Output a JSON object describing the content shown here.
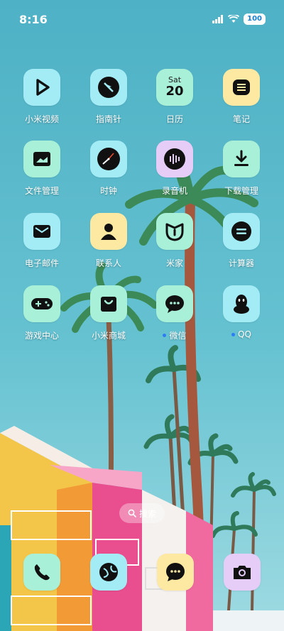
{
  "status_bar": {
    "time": "8:16",
    "battery": "100"
  },
  "apps": [
    {
      "label": "小米视频",
      "icon": "play-icon",
      "color": "#a3ecf6"
    },
    {
      "label": "指南针",
      "icon": "compass-icon",
      "color": "#a3ecf6"
    },
    {
      "label": "日历",
      "icon": "calendar-icon",
      "color": "#a8f0d8",
      "day": "Sat",
      "date": "20"
    },
    {
      "label": "笔记",
      "icon": "notes-icon",
      "color": "#fde9a2"
    },
    {
      "label": "文件管理",
      "icon": "folder-icon",
      "color": "#a8f0d8"
    },
    {
      "label": "时钟",
      "icon": "clock-icon",
      "color": "#a3ecf6"
    },
    {
      "label": "录音机",
      "icon": "recorder-icon",
      "color": "#e5cdf7"
    },
    {
      "label": "下载管理",
      "icon": "download-icon",
      "color": "#a8f0d8"
    },
    {
      "label": "电子邮件",
      "icon": "mail-icon",
      "color": "#a3ecf6"
    },
    {
      "label": "联系人",
      "icon": "person-icon",
      "color": "#fde9a2"
    },
    {
      "label": "米家",
      "icon": "mijia-icon",
      "color": "#a8f0d8"
    },
    {
      "label": "计算器",
      "icon": "calculator-icon",
      "color": "#a3ecf6"
    },
    {
      "label": "游戏中心",
      "icon": "gamepad-icon",
      "color": "#a8f0d8"
    },
    {
      "label": "小米商城",
      "icon": "shop-bag-icon",
      "color": "#a8f0d8"
    },
    {
      "label": "微信",
      "icon": "chat-bubble-icon",
      "color": "#a8f0d8",
      "notification_dot": true
    },
    {
      "label": "QQ",
      "icon": "penguin-icon",
      "color": "#a3ecf6",
      "notification_dot": true
    }
  ],
  "search": {
    "label": "搜索"
  },
  "dock": [
    {
      "icon": "phone-icon",
      "color": "#a8f0d8"
    },
    {
      "icon": "browser-icon",
      "color": "#a3ecf6"
    },
    {
      "icon": "messages-icon",
      "color": "#fde9a2"
    },
    {
      "icon": "camera-icon",
      "color": "#e5cdf7"
    }
  ]
}
